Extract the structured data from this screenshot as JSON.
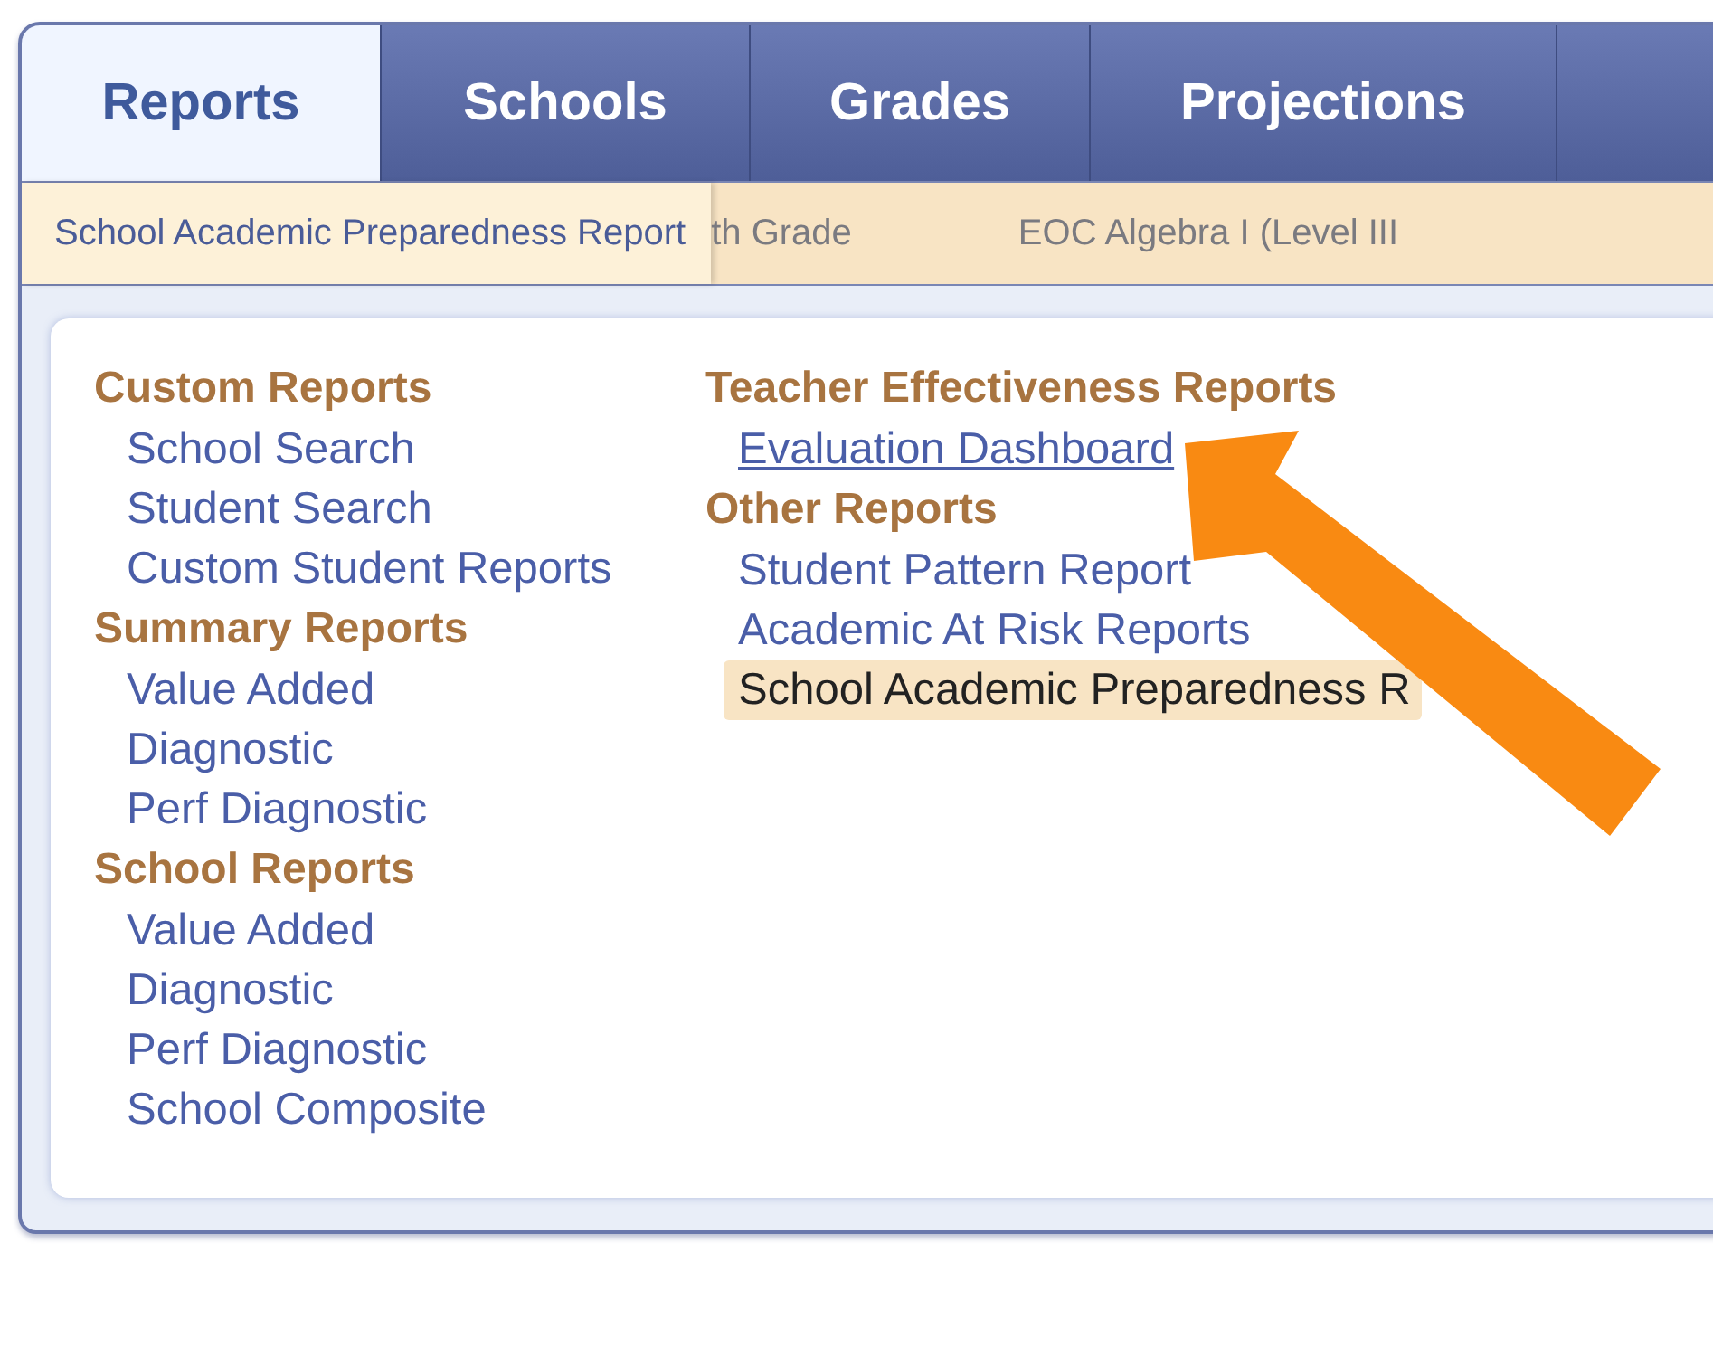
{
  "tabs": [
    {
      "label": "Reports",
      "selected": true
    },
    {
      "label": "Schools",
      "selected": false
    },
    {
      "label": "Grades",
      "selected": false
    },
    {
      "label": "Projections",
      "selected": false
    }
  ],
  "subnav": [
    {
      "label": "School Academic Preparedness Report",
      "selected": true
    },
    {
      "label": "th Grade",
      "selected": false
    },
    {
      "label": "EOC Algebra I (Level III",
      "selected": false
    }
  ],
  "columns": [
    {
      "sections": [
        {
          "heading": "Custom Reports",
          "items": [
            {
              "label": "School Search",
              "selected": false,
              "hovered": false
            },
            {
              "label": "Student Search",
              "selected": false,
              "hovered": false
            },
            {
              "label": "Custom Student Reports",
              "selected": false,
              "hovered": false
            }
          ]
        },
        {
          "heading": "Summary Reports",
          "items": [
            {
              "label": "Value Added",
              "selected": false,
              "hovered": false
            },
            {
              "label": "Diagnostic",
              "selected": false,
              "hovered": false
            },
            {
              "label": "Perf Diagnostic",
              "selected": false,
              "hovered": false
            }
          ]
        },
        {
          "heading": "School Reports",
          "items": [
            {
              "label": "Value Added",
              "selected": false,
              "hovered": false
            },
            {
              "label": "Diagnostic",
              "selected": false,
              "hovered": false
            },
            {
              "label": "Perf Diagnostic",
              "selected": false,
              "hovered": false
            },
            {
              "label": "School Composite",
              "selected": false,
              "hovered": false
            }
          ]
        }
      ]
    },
    {
      "sections": [
        {
          "heading": "Teacher Effectiveness Reports",
          "items": [
            {
              "label": "Evaluation Dashboard",
              "selected": false,
              "hovered": true
            }
          ]
        },
        {
          "heading": "Other Reports",
          "items": [
            {
              "label": "Student Pattern Report",
              "selected": false,
              "hovered": false
            },
            {
              "label": "Academic At Risk Reports",
              "selected": false,
              "hovered": false
            },
            {
              "label": "School Academic Preparedness R",
              "selected": true,
              "hovered": false
            }
          ]
        }
      ]
    }
  ]
}
